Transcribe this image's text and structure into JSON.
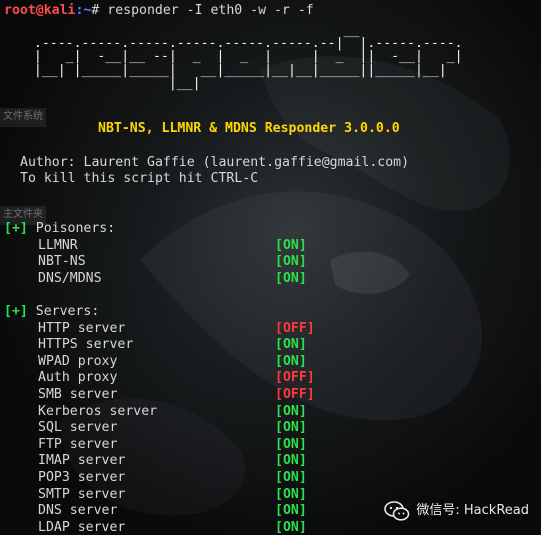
{
  "prompt": {
    "user_host": "root@kali",
    "path": ":~",
    "symbol": "#",
    "command": "responder -I eth0 -w -r -f"
  },
  "banner_art": "                                         __\n  .----.-----.-----.-----.-----.-----.--|  |.-----.----.\n  |   _|  -__|__ --|  _  |  _  |     |  _  ||  -__|   _|\n  |__| |_____|_____|   __|_____|__|__|_____||_____|__|\n                   |__|",
  "title": "NBT-NS, LLMNR & MDNS Responder 3.0.0.0",
  "author_line": "Author: Laurent Gaffie (laurent.gaffie@gmail.com)",
  "kill_line": "To kill this script hit CTRL-C",
  "poisoners": {
    "marker": "[+]",
    "heading": "Poisoners:",
    "items": [
      {
        "label": "LLMNR",
        "status": "[ON]",
        "state": "on"
      },
      {
        "label": "NBT-NS",
        "status": "[ON]",
        "state": "on"
      },
      {
        "label": "DNS/MDNS",
        "status": "[ON]",
        "state": "on"
      }
    ]
  },
  "servers": {
    "marker": "[+]",
    "heading": "Servers:",
    "items": [
      {
        "label": "HTTP server",
        "status": "[OFF]",
        "state": "off"
      },
      {
        "label": "HTTPS server",
        "status": "[ON]",
        "state": "on"
      },
      {
        "label": "WPAD proxy",
        "status": "[ON]",
        "state": "on"
      },
      {
        "label": "Auth proxy",
        "status": "[OFF]",
        "state": "off"
      },
      {
        "label": "SMB server",
        "status": "[OFF]",
        "state": "off"
      },
      {
        "label": "Kerberos server",
        "status": "[ON]",
        "state": "on"
      },
      {
        "label": "SQL server",
        "status": "[ON]",
        "state": "on"
      },
      {
        "label": "FTP server",
        "status": "[ON]",
        "state": "on"
      },
      {
        "label": "IMAP server",
        "status": "[ON]",
        "state": "on"
      },
      {
        "label": "POP3 server",
        "status": "[ON]",
        "state": "on"
      },
      {
        "label": "SMTP server",
        "status": "[ON]",
        "state": "on"
      },
      {
        "label": "DNS server",
        "status": "[ON]",
        "state": "on"
      },
      {
        "label": "LDAP server",
        "status": "[ON]",
        "state": "on"
      }
    ]
  },
  "side_labels": [
    "文件系统",
    "主文件夹"
  ],
  "watermark": {
    "icon": "wechat-icon",
    "text": "微信号: HackRead"
  },
  "colors": {
    "on": "#2ee04a",
    "off": "#ff3a3a",
    "title": "#ffd700",
    "prompt_user": "#ff4a4a",
    "prompt_path": "#4f8cff"
  }
}
